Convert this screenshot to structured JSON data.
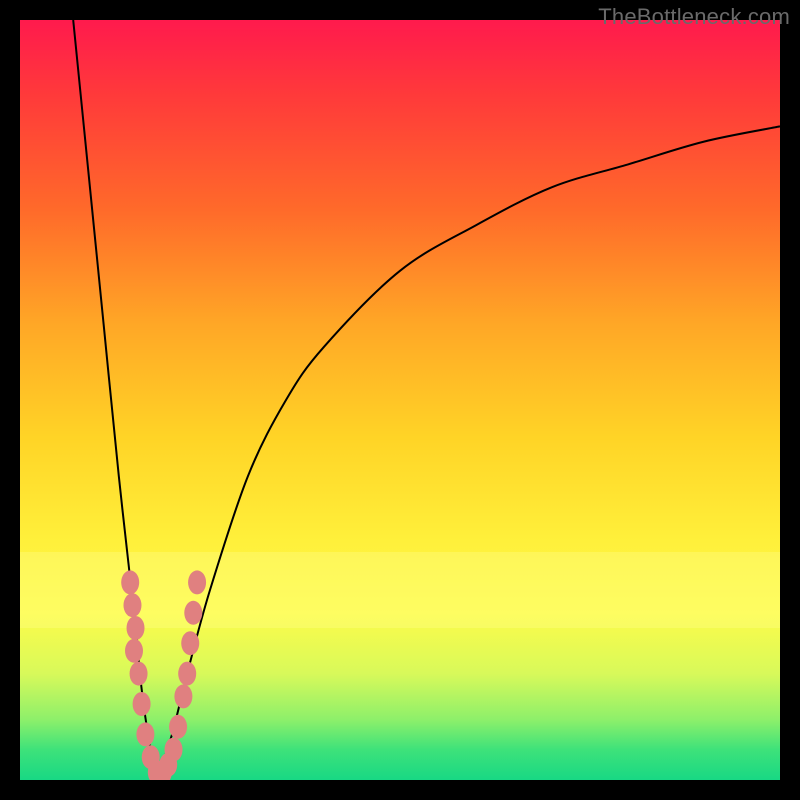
{
  "watermark": "TheBottleneck.com",
  "colors": {
    "frame": "#000000",
    "bead": "#e08080",
    "curve": "#000000"
  },
  "chart_data": {
    "type": "line",
    "title": "",
    "xlabel": "",
    "ylabel": "",
    "x_range": [
      0,
      100
    ],
    "y_range": [
      0,
      100
    ],
    "optimum_x": 18,
    "note": "V-shaped bottleneck curve: y is percentage bottleneck (0 = green/bottom, 100 = red/top). Minimum at x≈18. Left branch falls steeply from (7,100) to (18,0); right branch rises with diminishing slope toward (100,~86).",
    "series": [
      {
        "name": "left-branch",
        "x": [
          7,
          9,
          11,
          13,
          15,
          16,
          17,
          18
        ],
        "y": [
          100,
          80,
          60,
          40,
          22,
          12,
          5,
          0
        ]
      },
      {
        "name": "right-branch",
        "x": [
          18,
          20,
          22,
          25,
          30,
          35,
          40,
          50,
          60,
          70,
          80,
          90,
          100
        ],
        "y": [
          0,
          6,
          14,
          25,
          40,
          50,
          57,
          67,
          73,
          78,
          81,
          84,
          86
        ]
      }
    ],
    "beads": {
      "note": "salmon data markers clustered near the valley",
      "points": [
        {
          "x": 14.5,
          "y": 26
        },
        {
          "x": 14.8,
          "y": 23
        },
        {
          "x": 15.2,
          "y": 20
        },
        {
          "x": 15.0,
          "y": 17
        },
        {
          "x": 15.6,
          "y": 14
        },
        {
          "x": 16.0,
          "y": 10
        },
        {
          "x": 16.5,
          "y": 6
        },
        {
          "x": 17.2,
          "y": 3
        },
        {
          "x": 18.0,
          "y": 1
        },
        {
          "x": 18.8,
          "y": 1
        },
        {
          "x": 19.5,
          "y": 2
        },
        {
          "x": 20.2,
          "y": 4
        },
        {
          "x": 20.8,
          "y": 7
        },
        {
          "x": 21.5,
          "y": 11
        },
        {
          "x": 22.0,
          "y": 14
        },
        {
          "x": 22.4,
          "y": 18
        },
        {
          "x": 22.8,
          "y": 22
        },
        {
          "x": 23.3,
          "y": 26
        }
      ]
    },
    "highlight_band_y": [
      20,
      30
    ]
  }
}
